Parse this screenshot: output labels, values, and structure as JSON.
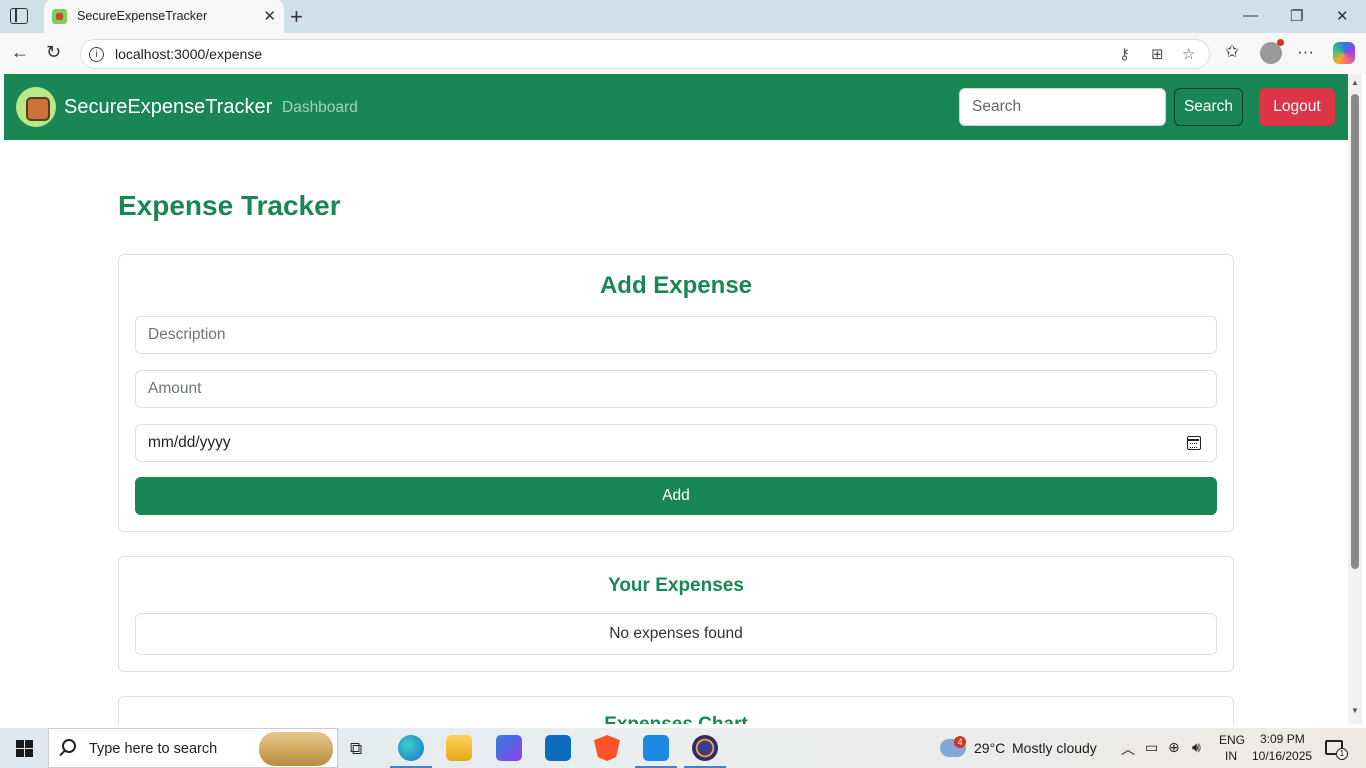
{
  "browser": {
    "tab_title": "SecureExpenseTracker",
    "url": "localhost:3000/expense"
  },
  "navbar": {
    "brand": "SecureExpenseTracker",
    "link_dashboard": "Dashboard",
    "search_placeholder": "Search",
    "search_button": "Search",
    "logout_button": "Logout",
    "colors": {
      "primary": "#198754",
      "danger": "#dc3545"
    }
  },
  "page": {
    "title": "Expense Tracker",
    "add_card": {
      "title": "Add Expense",
      "description_placeholder": "Description",
      "amount_placeholder": "Amount",
      "date_placeholder": "mm/dd/yyyy",
      "add_button": "Add"
    },
    "list_card": {
      "title": "Your Expenses",
      "empty_message": "No expenses found"
    },
    "chart_card": {
      "title": "Expenses Chart"
    }
  },
  "taskbar": {
    "search_placeholder": "Type here to search",
    "weather_badge": "4",
    "temperature": "29°C",
    "weather_text": "Mostly cloudy",
    "language_line1": "ENG",
    "language_line2": "IN",
    "time": "3:09 PM",
    "date": "10/16/2025",
    "notification_count": "1"
  },
  "icons": {
    "tab_sidebar": "tab-sidebar-icon",
    "favicon": "expense-app-favicon",
    "back": "back-arrow-icon",
    "refresh": "refresh-icon",
    "site_info": "info-icon",
    "calendar": "calendar-icon",
    "start": "windows-start-icon"
  }
}
